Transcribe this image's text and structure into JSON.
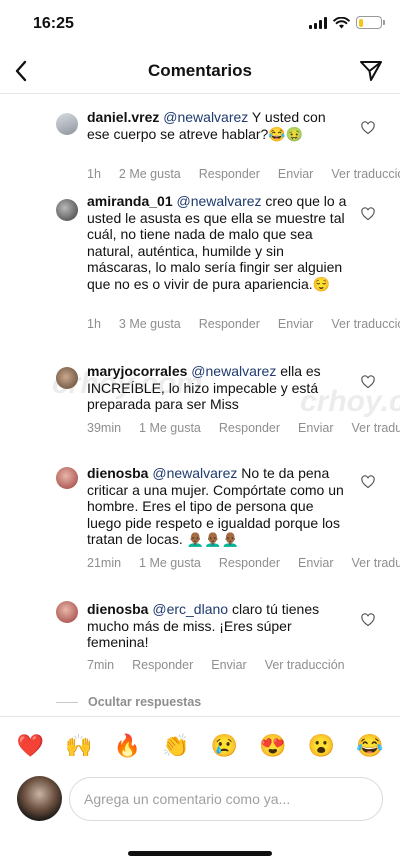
{
  "status": {
    "time": "16:25",
    "battery_level": 0.2
  },
  "header": {
    "title": "Comentarios",
    "back_icon": "chevron-left-icon",
    "send_icon": "paper-plane-icon"
  },
  "comments": [
    {
      "username": "daniel.vrez",
      "mention": "@newalvarez",
      "text": " Y usted con ese cuerpo se atreve hablar?😂🤢",
      "time": "1h",
      "likes": "2 Me gusta",
      "reply": "Responder",
      "send": "Enviar",
      "translate": "Ver traducción"
    },
    {
      "username": "amiranda_01",
      "mention": "@newalvarez",
      "text": " creo que lo a usted le asusta es que ella se muestre tal cuál, no tiene nada de malo que sea natural, auténtica, humilde y sin máscaras, lo malo sería fingir ser alguien que no es o vivir de pura apariencia.😌",
      "time": "1h",
      "likes": "3 Me gusta",
      "reply": "Responder",
      "send": "Enviar",
      "translate": "Ver traducción"
    },
    {
      "username": "maryjocorrales",
      "mention": "@newalvarez",
      "text": " ella es INCREÍBLE, lo hizo impecable y está preparada para ser Miss",
      "time": "39min",
      "likes": "1 Me gusta",
      "reply": "Responder",
      "send": "Enviar",
      "translate": "Ver traducción"
    },
    {
      "username": "dienosba",
      "mention": "@newalvarez",
      "text": " No te da pena criticar a una mujer. Compórtate como un hombre. Eres el tipo de persona que luego pide respeto e igualdad porque los tratan de locas. 👨🏾‍🦲👨🏾‍🦲👨🏾‍🦲",
      "time": "21min",
      "likes": "1 Me gusta",
      "reply": "Responder",
      "send": "Enviar",
      "translate": "Ver traducción"
    },
    {
      "username": "dienosba",
      "mention": "@erc_dlano",
      "text": " claro tú tienes mucho más de miss. ¡Eres súper femenina!",
      "time": "7min",
      "reply": "Responder",
      "send": "Enviar",
      "translate": "Ver traducción"
    }
  ],
  "hide_replies": "Ocultar respuestas",
  "watermark": "crhoy.com",
  "emojis": [
    "❤️",
    "🙌",
    "🔥",
    "👏",
    "😢",
    "😍",
    "😮",
    "😂"
  ],
  "compose": {
    "placeholder": "Agrega un comentario como ya..."
  }
}
